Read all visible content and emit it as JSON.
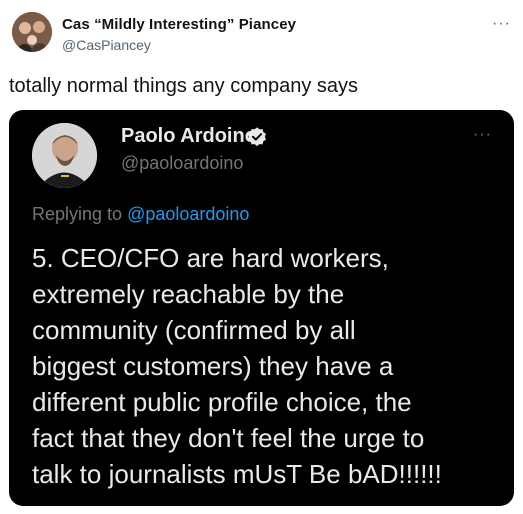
{
  "outer_tweet": {
    "author_name": "Cas “Mildly Interesting” Piancey",
    "author_handle": "@CasPiancey",
    "more_glyph": "···",
    "text": "totally normal things any company says"
  },
  "embedded_tweet": {
    "author_name": "Paolo Ardoino",
    "author_handle": "@paoloardoino",
    "more_glyph": "···",
    "replying_prefix": "Replying to ",
    "replying_mention": "@paoloardoino",
    "body": "5. CEO/CFO are hard workers,\nextremely reachable by the\ncommunity (confirmed by all\nbiggest customers) they have a\ndifferent public profile choice, the\nfact that they don't feel the urge to\ntalk to journalists mUsT Be bAD!!!!!!"
  },
  "colors": {
    "accent_blue": "#1d9bf0",
    "dark_bg": "#000000",
    "light_text": "#e7e9ea",
    "muted_text": "#71767b"
  }
}
